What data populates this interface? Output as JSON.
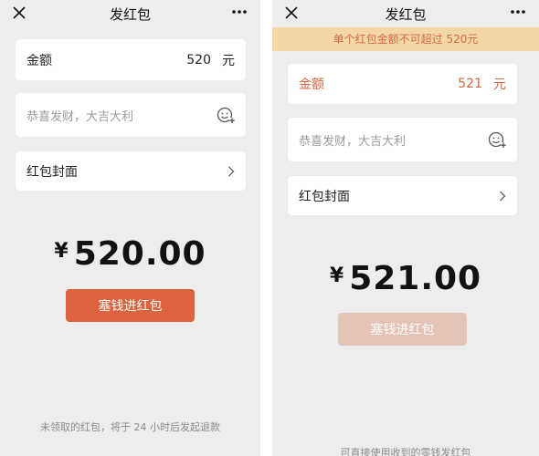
{
  "left": {
    "title": "发红包",
    "amount": {
      "label": "金额",
      "value": "520",
      "unit": "元"
    },
    "greeting": {
      "placeholder": "恭喜发财，大吉大利"
    },
    "cover": {
      "label": "红包封面"
    },
    "total": {
      "currency": "¥",
      "amount": "520.00"
    },
    "send_button": "塞钱进红包",
    "footer": "未领取的红包，将于 24 小时后发起退款"
  },
  "right": {
    "title": "发红包",
    "banner": "单个红包金额不可超过 520元",
    "amount": {
      "label": "金额",
      "value": "521",
      "unit": "元"
    },
    "greeting": {
      "placeholder": "恭喜发财，大吉大利"
    },
    "cover": {
      "label": "红包封面"
    },
    "total": {
      "currency": "¥",
      "amount": "521.00"
    },
    "send_button": "塞钱进红包",
    "footer": "可直接使用收到的零钱发红包"
  },
  "colors": {
    "accent": "#db643f",
    "accent_disabled": "#e6c3b7",
    "error_text": "#d56541",
    "banner_bg": "#f3d7a5",
    "page_bg": "#ededed"
  },
  "icons": [
    "close-icon",
    "more-icon",
    "emoji-add-icon",
    "chevron-right-icon"
  ]
}
